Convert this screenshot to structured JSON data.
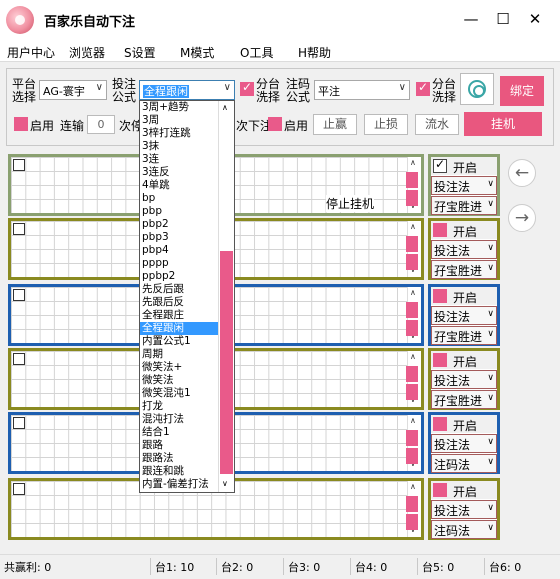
{
  "window": {
    "title": "百家乐自动下注",
    "minimize": "—",
    "maximize": "☐",
    "close": "✕"
  },
  "menu": [
    "用户中心",
    "浏览器",
    "S设置",
    "M模式",
    "O工具",
    "H帮助"
  ],
  "controls": {
    "platform_label": "平台\n选择",
    "platform_value": "AG-寰宇",
    "bet_formula_label": "投注\n公式",
    "bet_formula_value": "全程跟闲",
    "split_wash_label1": "分台\n洗择",
    "bet_code_label": "注码\n公式",
    "bet_code_value": "平注",
    "split_wash_label2": "分台\n洗择",
    "bind_button": "绑定",
    "enable_label1": "启用",
    "lose_label": "连输",
    "lose_count": "0",
    "times_prefix": "次停",
    "times_suffix": "次下注",
    "enable_label2": "启用",
    "stop_win": "止赢",
    "stop_loss": "止损",
    "flow": "流水",
    "hang_button": "挂机"
  },
  "dropdown_options": [
    "3周+趋势",
    "3周",
    "3梓打连跳",
    "3抹",
    "3连",
    "3连反",
    "4单跳",
    "bp",
    "pbp",
    "pbp2",
    "pbp3",
    "pbp4",
    "pppp",
    "ppbp2",
    "先反后跟",
    "先跟后反",
    "全程跟庄",
    "全程跟闲",
    "内置公式1",
    "周期",
    "微笑法+",
    "微笑法",
    "微笑混沌1",
    "打龙",
    "混沌打法",
    "结合1",
    "跟路",
    "跟路法",
    "跟连和跳",
    "内置-偏差打法"
  ],
  "dropdown_selected_index": 17,
  "stop_hang_text": "停止挂机",
  "tables": [
    {
      "border_color": "#8aa070",
      "start_label": "开启",
      "started": true,
      "select1": "投注法",
      "select2": "孖宝胜进"
    },
    {
      "border_color": "#8a8a20",
      "start_label": "开启",
      "started": false,
      "select1": "投注法",
      "select2": "孖宝胜进"
    },
    {
      "border_color": "#1e5fb0",
      "start_label": "开启",
      "started": false,
      "select1": "投注法",
      "select2": "孖宝胜进"
    },
    {
      "border_color": "#8a8a20",
      "start_label": "开启",
      "started": false,
      "select1": "投注法",
      "select2": "孖宝胜进"
    },
    {
      "border_color": "#1e5fb0",
      "start_label": "开启",
      "started": false,
      "select1": "投注法",
      "select2": "注码法"
    },
    {
      "border_color": "#8a8a20",
      "start_label": "开启",
      "started": false,
      "select1": "投注法",
      "select2": "注码法"
    }
  ],
  "status": [
    "共赢利: 0",
    "台1: 10",
    "台2: 0",
    "台3: 0",
    "台4: 0",
    "台5: 0",
    "台6: 0"
  ],
  "colors": {
    "accent_pink": "#e9577f",
    "selection_blue": "#3399ff"
  }
}
